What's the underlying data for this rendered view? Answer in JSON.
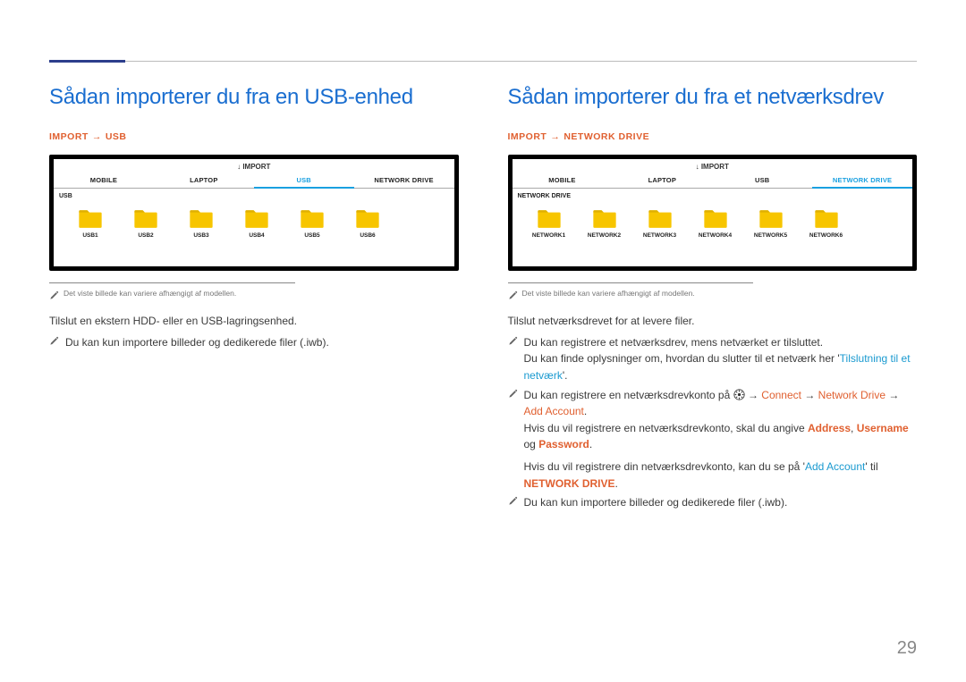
{
  "pageNumber": "29",
  "left": {
    "title": "Sådan importerer du fra en USB-enhed",
    "crumb1": "IMPORT",
    "crumb2": "USB",
    "frame": {
      "header": "IMPORT",
      "tabs": [
        "MOBILE",
        "LAPTOP",
        "USB",
        "NETWORK DRIVE"
      ],
      "activeTab": 2,
      "subtitle": "USB",
      "folders": [
        "USB1",
        "USB2",
        "USB3",
        "USB4",
        "USB5",
        "USB6"
      ]
    },
    "smallNote": "Det viste billede kan variere afhængigt af modellen.",
    "instr": "Tilslut en ekstern HDD- eller en USB-lagringsenhed.",
    "pen1": "Du kan kun importere billeder og dedikerede filer (.iwb)."
  },
  "right": {
    "title": "Sådan importerer du fra et netværksdrev",
    "crumb1": "IMPORT",
    "crumb2": "NETWORK DRIVE",
    "frame": {
      "header": "IMPORT",
      "tabs": [
        "MOBILE",
        "LAPTOP",
        "USB",
        "NETWORK DRIVE"
      ],
      "activeTab": 3,
      "subtitle": "NETWORK DRIVE",
      "folders": [
        "NETWORK1",
        "NETWORK2",
        "NETWORK3",
        "NETWORK4",
        "NETWORK5",
        "NETWORK6"
      ]
    },
    "smallNote": "Det viste billede kan variere afhængigt af modellen.",
    "instr": "Tilslut netværksdrevet for at levere filer.",
    "pen1a": "Du kan registrere et netværksdrev, mens netværket er tilsluttet.",
    "pen1b_pre": "Du kan finde oplysninger om, hvordan du slutter til et netværk her '",
    "pen1b_link": "Tilslutning til et netværk",
    "pen1b_post": "'.",
    "pen2_pre": "Du kan registrere en netværksdrevkonto på ",
    "pen2_arrow1": " → ",
    "pen2_connect": "Connect",
    "pen2_nd": "Network Drive",
    "pen2_aa": "Add Account",
    "pen2_end": ".",
    "pen2b_pre": "Hvis du vil registrere en netværksdrevkonto, skal du angive ",
    "pen2b_addr": "Address",
    "pen2b_sep1": ", ",
    "pen2b_user": "Username",
    "pen2b_sep2": " og ",
    "pen2b_pw": "Password",
    "pen2b_end": ".",
    "pen2c_pre": "Hvis du vil registrere din netværksdrevkonto, kan du se på '",
    "pen2c_link": "Add Account",
    "pen2c_mid": "' til ",
    "pen2c_nd": "NETWORK DRIVE",
    "pen2c_end": ".",
    "pen3": "Du kan kun importere billeder og dedikerede filer (.iwb)."
  }
}
